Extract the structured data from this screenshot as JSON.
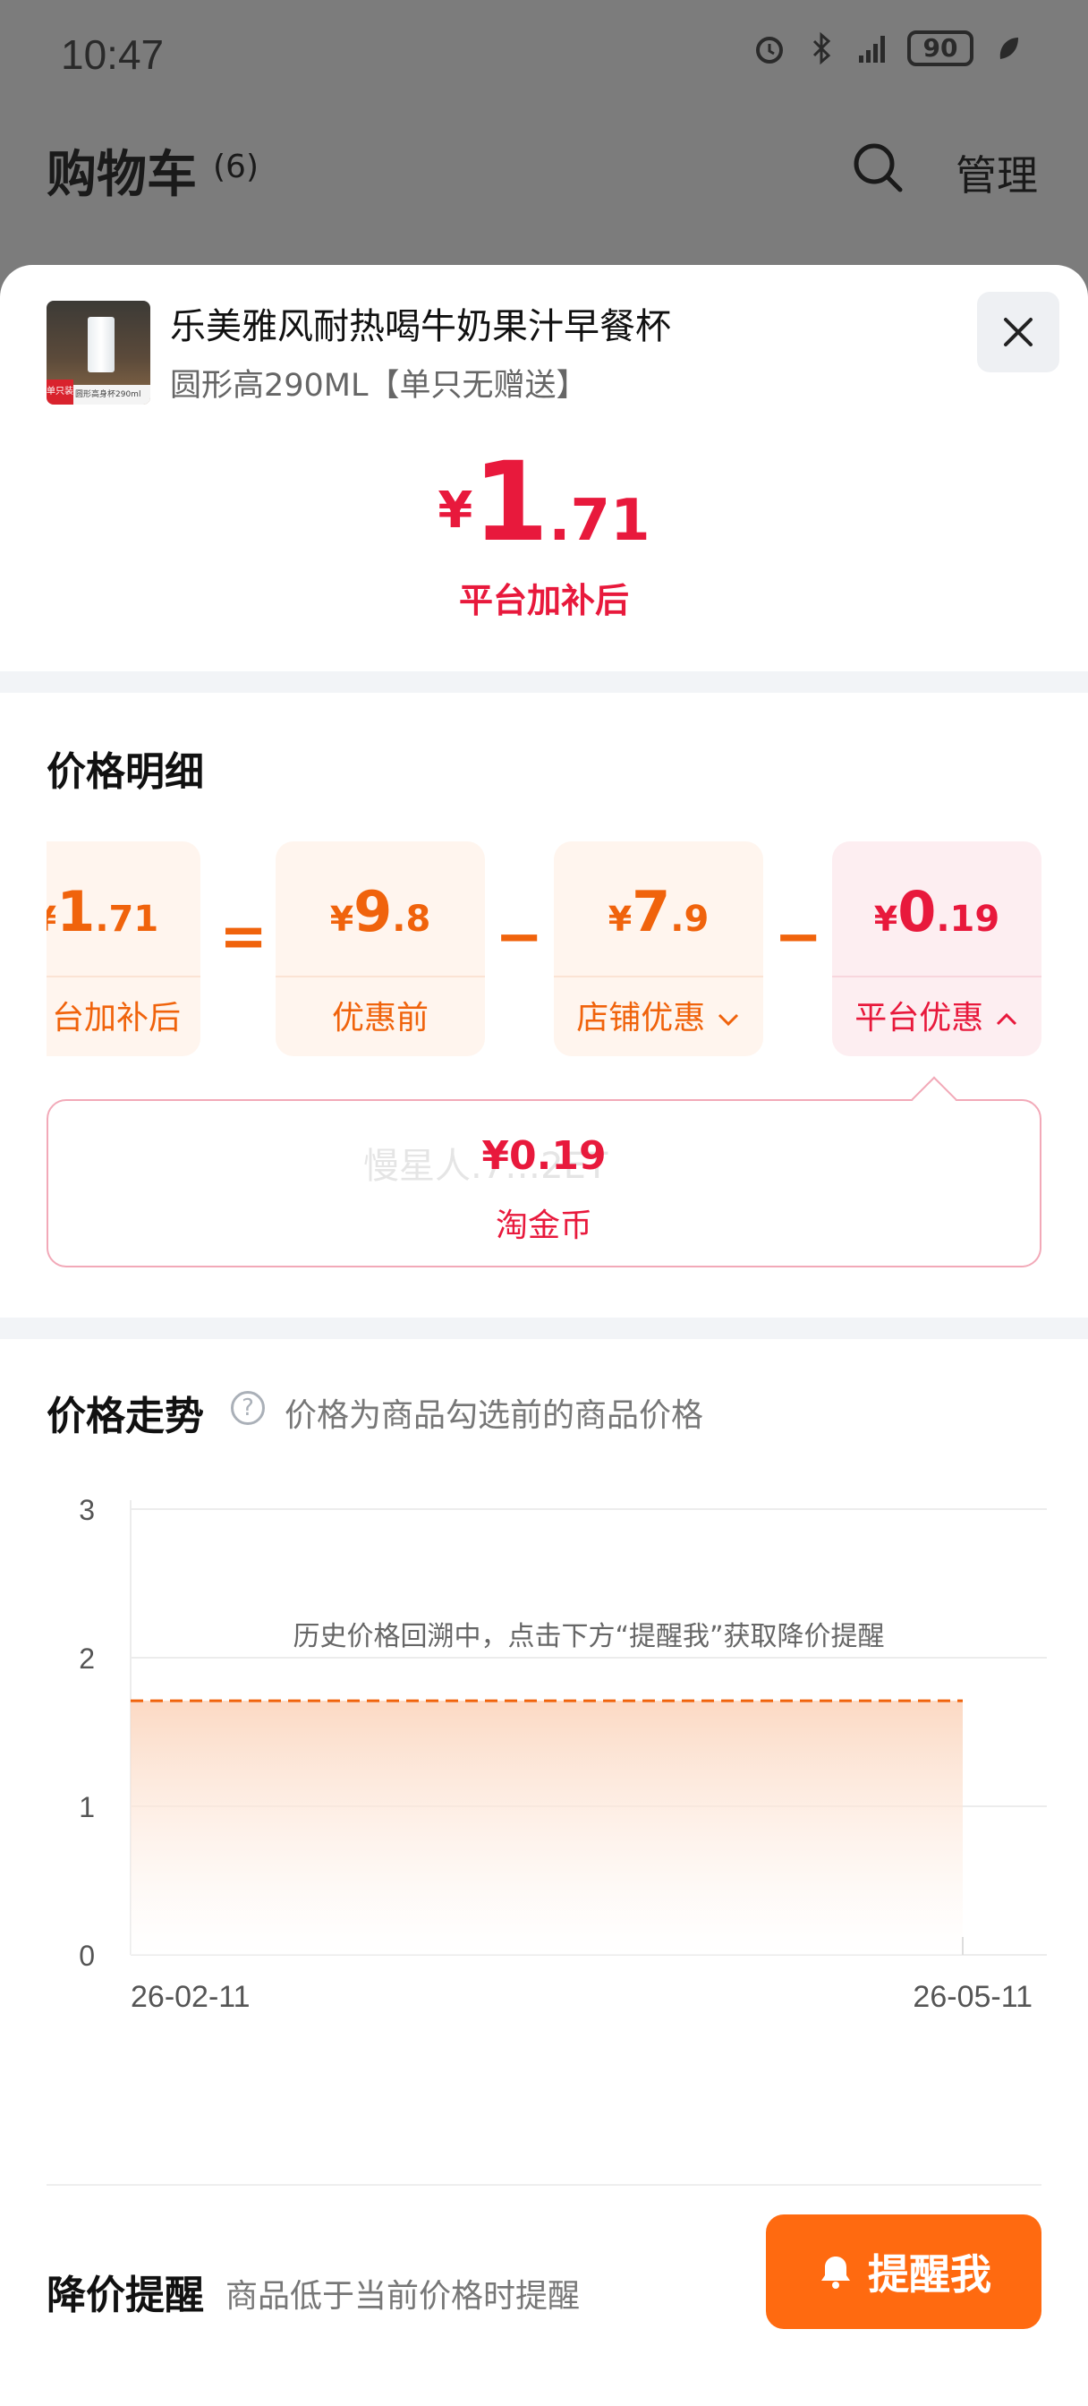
{
  "status_bar": {
    "time": "10:47",
    "battery": "90"
  },
  "background_page": {
    "title": "购物车",
    "count": "(6)",
    "manage": "管理"
  },
  "product": {
    "title": "乐美雅风耐热喝牛奶果汁早餐杯",
    "spec": "圆形高290ML【单只无赠送】",
    "thumb_badge": "单只装",
    "thumb_caption": "圆形高身杯290ml"
  },
  "final_price": {
    "yen": "¥",
    "int": "1",
    "dec": ".71",
    "caption": "平台加补后"
  },
  "breakdown": {
    "title": "价格明细",
    "cards": [
      {
        "yen": "¥",
        "int": "1",
        "dec": ".71",
        "label": "台加补后"
      },
      {
        "yen": "¥",
        "int": "9",
        "dec": ".8",
        "label": "优惠前"
      },
      {
        "yen": "¥",
        "int": "7",
        "dec": ".9",
        "label": "店铺优惠"
      },
      {
        "yen": "¥",
        "int": "0",
        "dec": ".19",
        "label": "平台优惠"
      }
    ],
    "ops": [
      "=",
      "−",
      "−"
    ],
    "coin": {
      "amount": "¥0.19",
      "label": "淘金币",
      "watermark": "慢星人.7…2ET"
    }
  },
  "trend": {
    "title": "价格走势",
    "help_icon": "?",
    "note": "价格为商品勾选前的商品价格"
  },
  "chart_data": {
    "type": "area",
    "x": [
      "26-02-11",
      "26-05-11"
    ],
    "y_ticks": [
      0,
      1,
      2,
      3
    ],
    "ylim": [
      0,
      3
    ],
    "series": [
      {
        "values": [
          1.71,
          1.71
        ],
        "color": "#f0630c"
      }
    ],
    "annotation": "历史价格回溯中，点击下方“提醒我”获取降价提醒",
    "grid": true
  },
  "remind": {
    "title": "降价提醒",
    "desc": "商品低于当前价格时提醒",
    "button": "提醒我"
  },
  "colors": {
    "accent_red": "#e8193c",
    "accent_orange": "#f0630c",
    "button_orange": "#ff6a10"
  }
}
